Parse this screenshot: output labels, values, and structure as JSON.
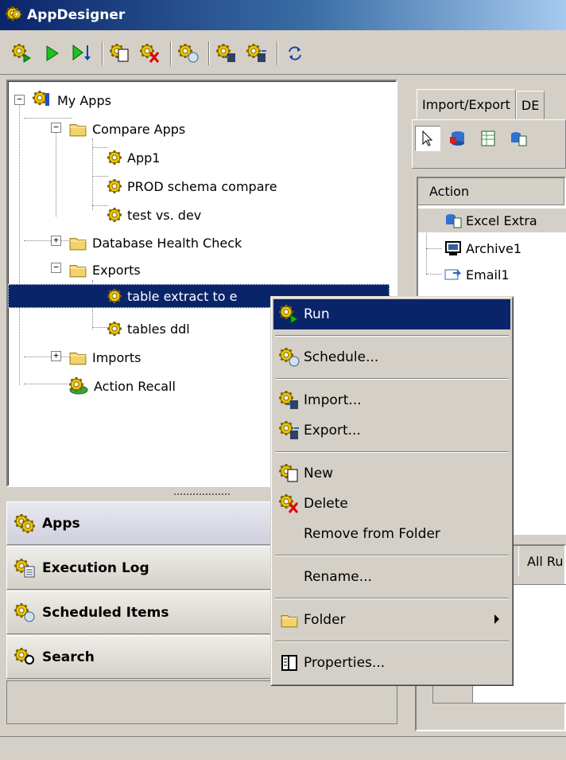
{
  "window": {
    "title": "AppDesigner"
  },
  "toolbar": {
    "buttons": [
      "run-app-icon",
      "play-icon",
      "step-run-icon",
      "new-app-icon",
      "delete-app-icon",
      "schedule-icon",
      "import-icon",
      "export-icon",
      "refresh-icon"
    ]
  },
  "tree": {
    "root": "My Apps",
    "compare_folder": "Compare Apps",
    "app1": "App1",
    "prod_compare": "PROD schema compare",
    "test_dev": "test vs. dev",
    "health_folder": "Database Health Check",
    "exports_folder": "Exports",
    "table_extract": "table extract to e",
    "tables_ddl": "tables ddl",
    "imports_folder": "Imports",
    "action_recall": "Action Recall"
  },
  "nav": {
    "apps": "Apps",
    "execution_log": "Execution Log",
    "scheduled_items": "Scheduled Items",
    "search": "Search"
  },
  "right": {
    "tab_import_export": "Import/Export",
    "tab_db": "DE",
    "action_header": "Action",
    "actions": [
      "Excel Extra",
      "Archive1",
      "Email1"
    ],
    "bottom_tab": "All Ru"
  },
  "context_menu": {
    "run": "Run",
    "schedule": "Schedule...",
    "import": "Import...",
    "export": "Export...",
    "new": "New",
    "delete": "Delete",
    "remove_from_folder": "Remove from Folder",
    "rename": "Rename...",
    "folder": "Folder",
    "properties": "Properties..."
  },
  "colors": {
    "selection": "#0a246a",
    "chrome": "#d4d0c8",
    "gear": "#d4b000",
    "folder": "#f2d36b"
  }
}
